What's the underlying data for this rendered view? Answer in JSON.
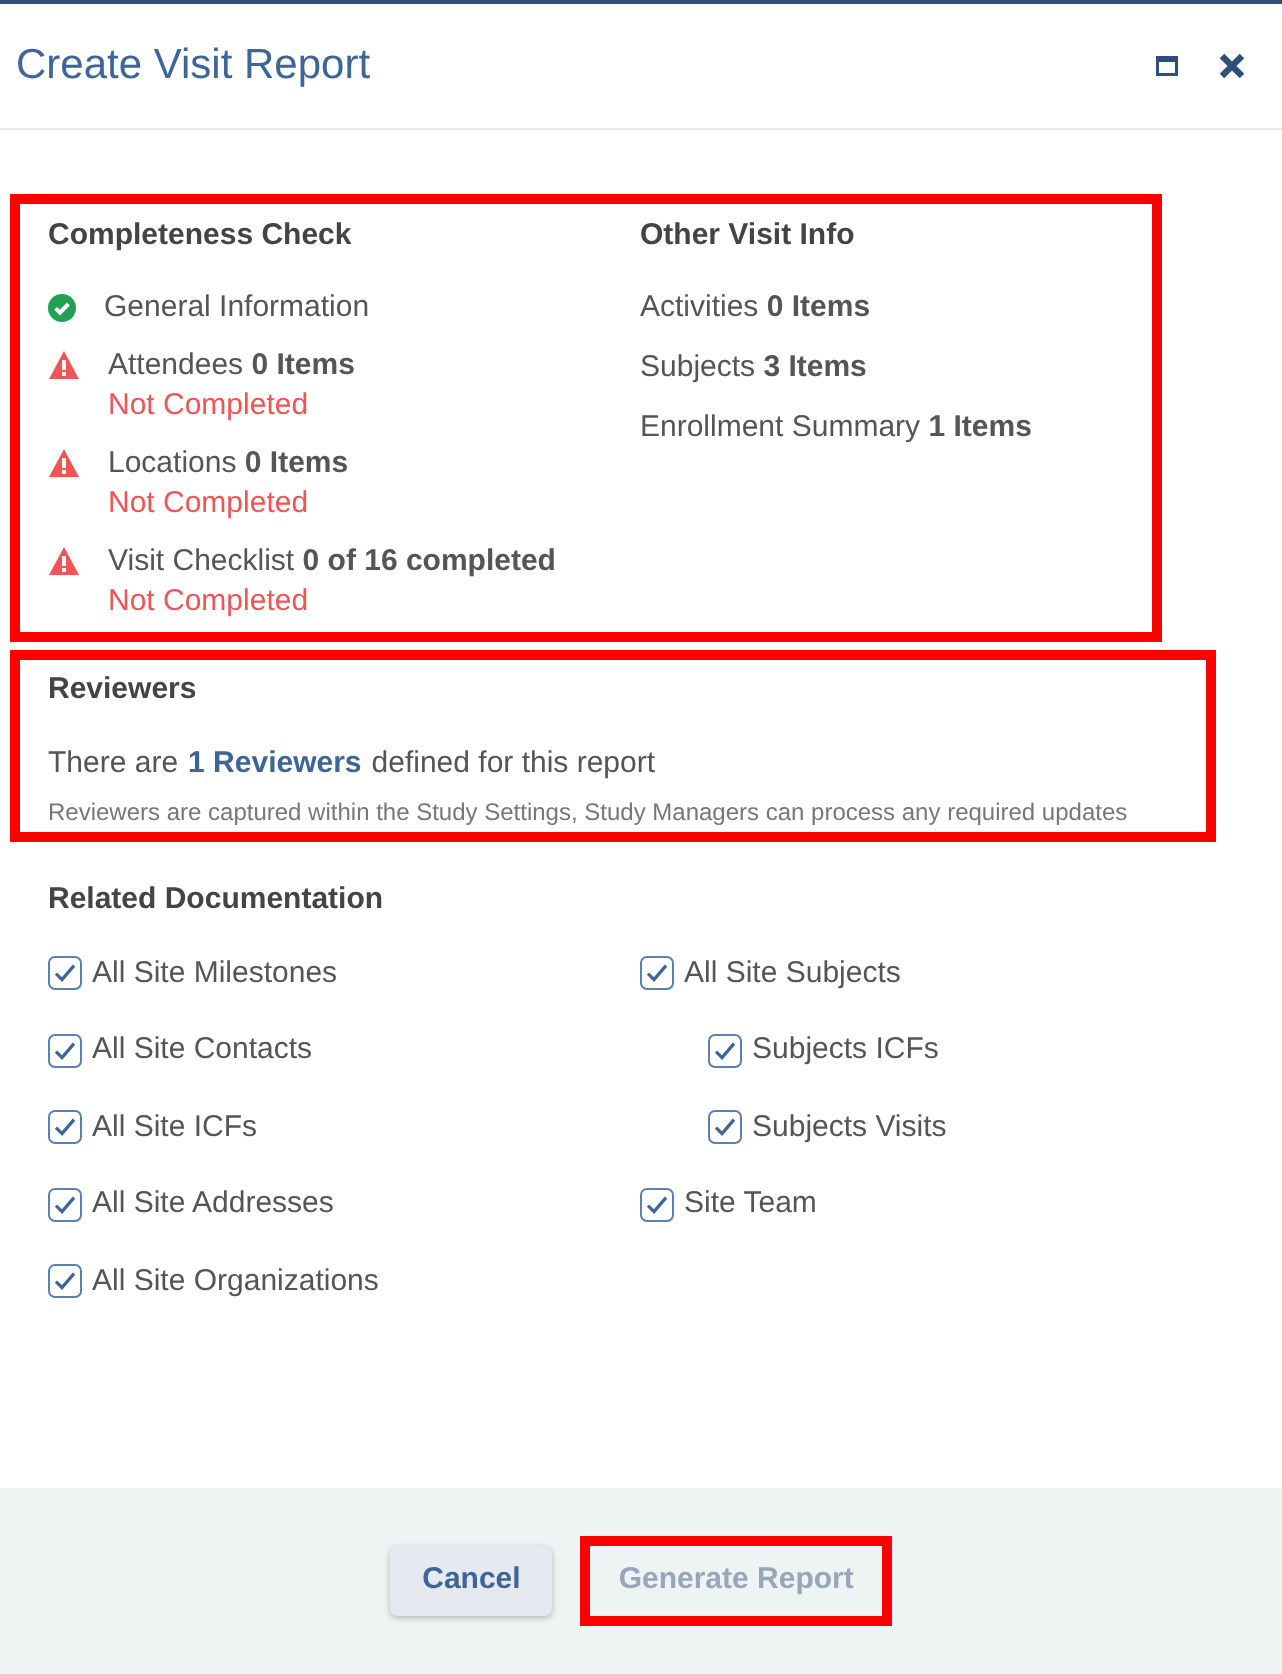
{
  "window": {
    "title": "Create Visit Report"
  },
  "completeness": {
    "title": "Completeness Check",
    "highlighted": true,
    "items": [
      {
        "label": "General Information",
        "kind": "complete"
      },
      {
        "label": "Attendees **0 Items**",
        "kind": "incomplete",
        "note": "Not Completed"
      },
      {
        "label": "Locations **0 Items**",
        "kind": "incomplete",
        "note": "Not Completed"
      },
      {
        "label": "Visit Checklist **0 of 16 completed**",
        "kind": "incomplete",
        "note": "Not Completed"
      }
    ]
  },
  "other_info": {
    "title": "Other Visit Info",
    "items": [
      "Activities **0 Items**",
      "Subjects **3 Items**",
      "Enrollment Summary **1 Items**"
    ]
  },
  "reviewers": {
    "title": "Reviewers",
    "highlighted": true,
    "text_before": "There are",
    "link": "1 Reviewers",
    "text_after": "defined for this report",
    "note": "Reviewers are captured within the Study Settings, Study Managers can process any required updates"
  },
  "related_documentation": {
    "title": "Related Documentation",
    "columns": [
      {
        "items": [
          {
            "label": "All Site Milestones",
            "checked": true
          },
          {
            "label": "All Site Contacts",
            "checked": true
          },
          {
            "label": "All Site ICFs",
            "checked": true
          },
          {
            "label": "All Site Addresses",
            "checked": true
          },
          {
            "label": "All Site Organizations",
            "checked": true
          }
        ]
      },
      {
        "items": [
          {
            "label": "All Site Subjects",
            "checked": true,
            "children": [
              {
                "label": "Subjects ICFs",
                "checked": true
              },
              {
                "label": "Subjects Visits",
                "checked": true
              }
            ]
          },
          {
            "label": "Site Team",
            "checked": true
          }
        ]
      }
    ]
  },
  "footer": {
    "buttons": [
      {
        "label": "Cancel",
        "kind": "secondary",
        "disabled": false,
        "highlighted": false
      },
      {
        "label": "Generate Report",
        "kind": "primary",
        "disabled": true,
        "highlighted": true
      }
    ]
  }
}
